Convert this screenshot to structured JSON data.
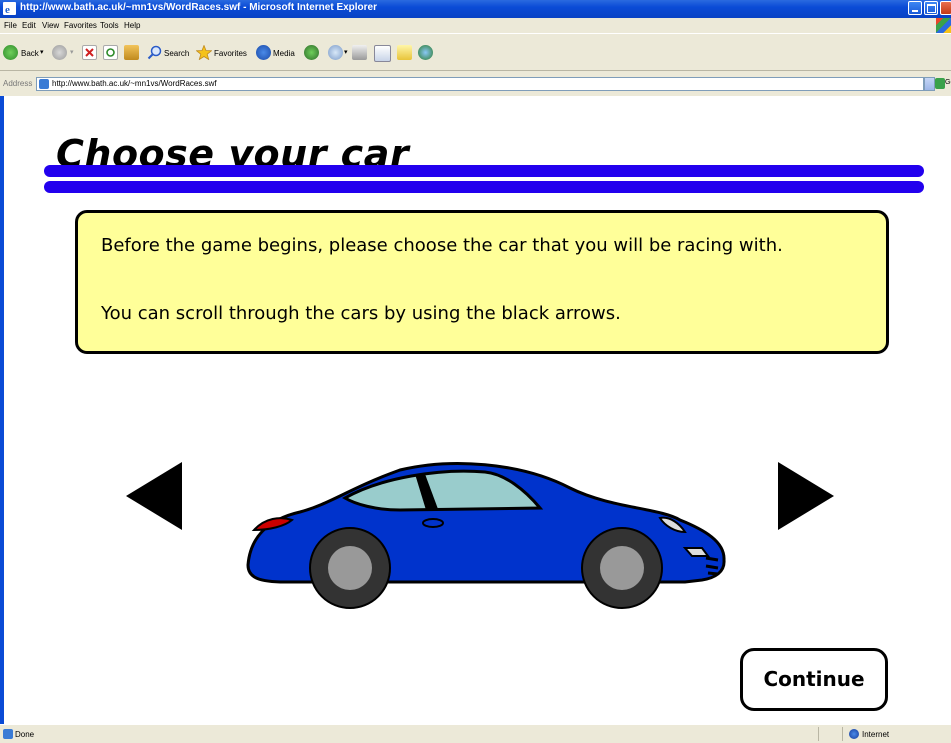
{
  "window": {
    "title": "http://www.bath.ac.uk/~mn1vs/WordRaces.swf - Microsoft Internet Explorer"
  },
  "menu": [
    "File",
    "Edit",
    "View",
    "Favorites",
    "Tools",
    "Help"
  ],
  "toolbar": {
    "back_label": "Back",
    "search_label": "Search",
    "favorites_label": "Favorites",
    "media_label": "Media"
  },
  "address": {
    "label": "Address",
    "url": "http://www.bath.ac.uk/~mn1vs/WordRaces.swf",
    "go_label": "Go"
  },
  "page": {
    "title": "Choose your car",
    "info_line1": "Before the game begins, please choose the car that you will be racing with.",
    "info_line2": "You can scroll through the cars by using the black arrows.",
    "continue_label": "Continue",
    "car_color": "#0033cc",
    "rule_color": "#2200ee",
    "box_color": "#ffff99"
  },
  "status": {
    "text": "Done",
    "zone": "Internet"
  }
}
